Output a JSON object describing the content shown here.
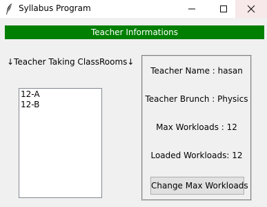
{
  "window": {
    "title": "Syllabus Program",
    "icon": "feather-icon",
    "controls": [
      "minimize-icon",
      "maximize-icon",
      "close-icon"
    ],
    "close_hover_color": "#f7e8e9"
  },
  "banner": {
    "text": "Teacher Informations",
    "background": "#007f00",
    "color": "#ffffff"
  },
  "classrooms": {
    "label": "↓Teacher Taking ClassRooms↓",
    "items": [
      "12-A",
      "12-B"
    ]
  },
  "info": {
    "name": "Teacher Name : hasan",
    "branch": "Teacher Brunch : Physics",
    "max_workloads": "Max Workloads : 12",
    "loaded_workloads": "Loaded Workloads: 12",
    "change_button": "Change Max Workloads"
  }
}
